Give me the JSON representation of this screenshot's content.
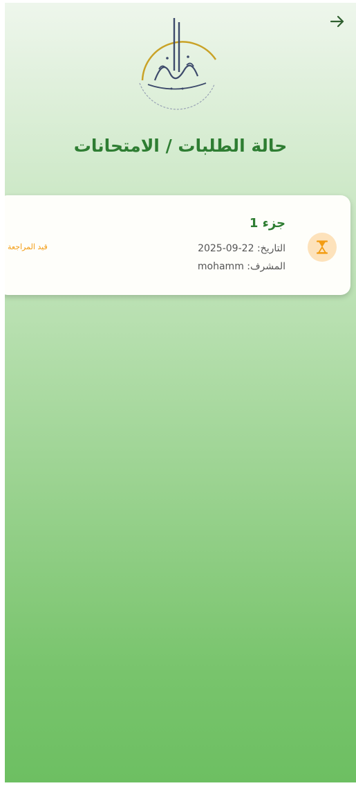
{
  "header": {
    "back_icon": "arrow-right-icon",
    "title": "حالة الطلبات / الامتحانات"
  },
  "logo": {
    "text": "ملتقى القرآن"
  },
  "requests": [
    {
      "title": "جزء 1",
      "date_label": "التاريخ:",
      "date_value": "22-09-2025",
      "supervisor_label": "المشرف:",
      "supervisor_value": "mohamm",
      "status": "قيد المراجعة",
      "status_icon": "hourglass-icon"
    }
  ],
  "colors": {
    "primary_green": "#2e7d32",
    "pending_orange": "#f39c12",
    "pending_bg": "#fde2bb"
  }
}
